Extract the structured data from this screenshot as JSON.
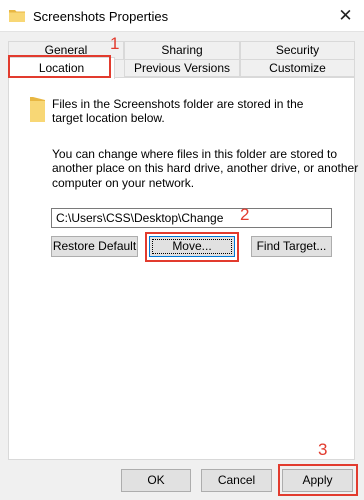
{
  "window": {
    "title": "Screenshots Properties",
    "close_glyph": "✕",
    "folder_icon": "folder-icon"
  },
  "tabs": {
    "row1": [
      "General",
      "Sharing",
      "Security"
    ],
    "row2": [
      "Location",
      "Previous Versions",
      "Customize"
    ],
    "selected": "Location"
  },
  "location": {
    "info_line1": "Files in the Screenshots folder are stored in the",
    "info_line2": "target location below.",
    "desc_line1": "You can change where files in this folder are stored to",
    "desc_line2": "another place on this hard drive, another drive, or another",
    "desc_line3": "computer on your network.",
    "path_value": "C:\\Users\\CSS\\Desktop\\Change",
    "buttons": {
      "restore_default": "Restore Default",
      "move": "Move...",
      "find_target": "Find Target..."
    }
  },
  "dialog_buttons": {
    "ok": "OK",
    "cancel": "Cancel",
    "apply": "Apply"
  },
  "annotations": [
    "1",
    "2",
    "3"
  ],
  "colors": {
    "annotation": "#e23b2e",
    "focus_border": "#0078d7",
    "folder": "#f8d775"
  }
}
